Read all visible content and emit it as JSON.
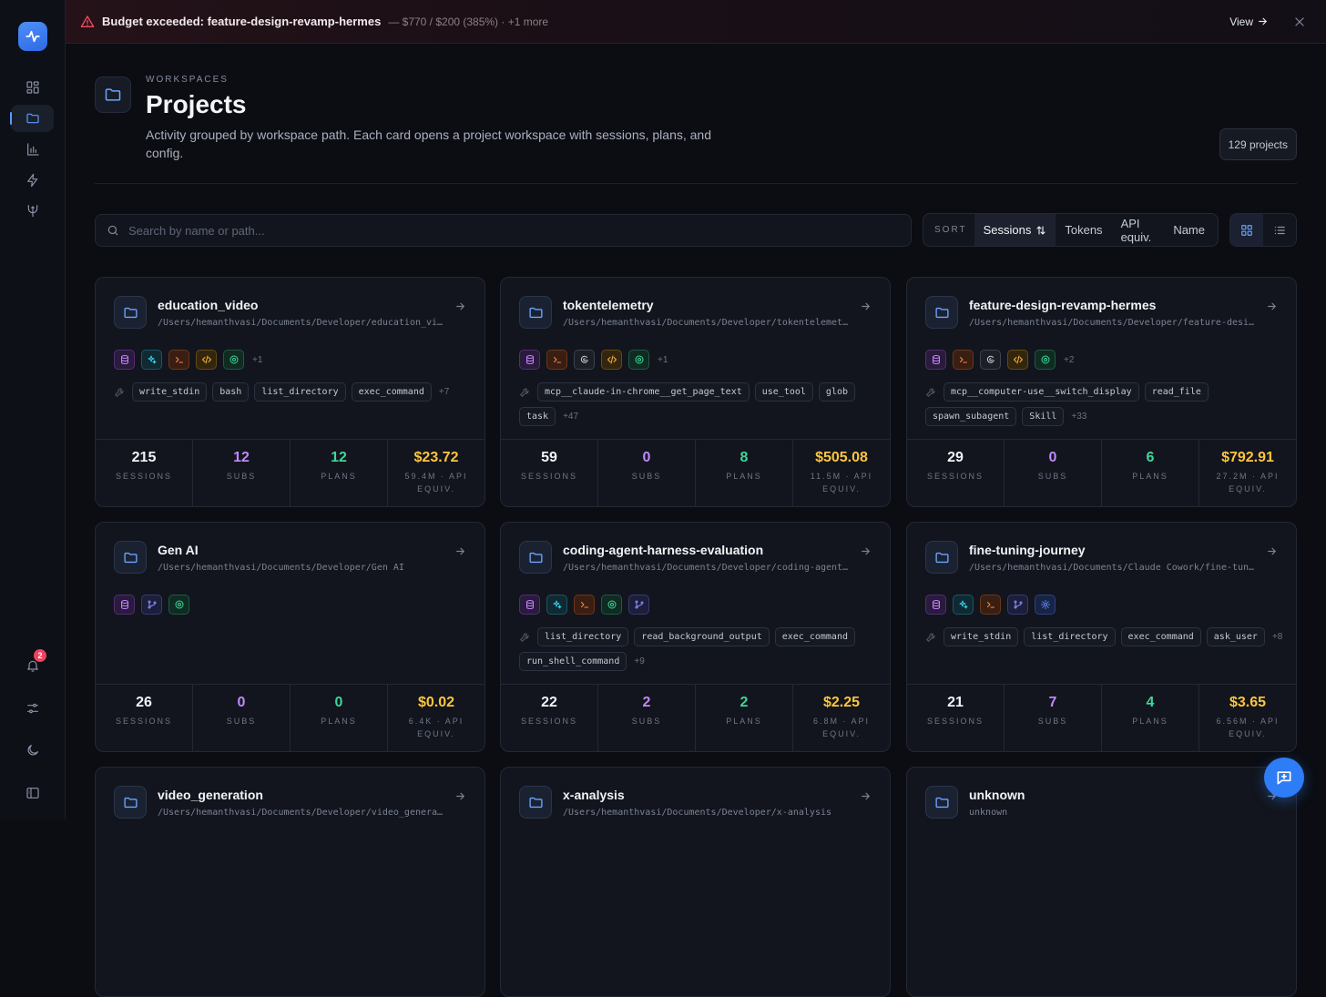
{
  "banner": {
    "title": "Budget exceeded: feature-design-revamp-hermes",
    "detail": "— $770 / $200 (385%) · +1 more",
    "view_label": "View"
  },
  "sidebar": {
    "notifications_count": "2"
  },
  "header": {
    "eyebrow": "WORKSPACES",
    "title": "Projects",
    "description": "Activity grouped by workspace path. Each card opens a project workspace with sessions, plans, and config.",
    "count": "129 projects"
  },
  "search": {
    "placeholder": "Search by name or path..."
  },
  "sort": {
    "label": "SORT",
    "options": [
      "Sessions",
      "Tokens",
      "API equiv.",
      "Name"
    ],
    "active": "Sessions"
  },
  "stat_labels": {
    "sessions": "SESSIONS",
    "subs": "SUBS",
    "plans": "PLANS"
  },
  "projects": [
    {
      "name": "education_video",
      "path": "/Users/hemanthvasi/Documents/Developer/education_video",
      "icons": [
        "db-icon",
        "ai-sparkle-icon",
        "terminal-icon",
        "code-icon",
        "gear-icon"
      ],
      "icons_more": "+1",
      "tags": [
        "write_stdin",
        "bash",
        "list_directory",
        "exec_command"
      ],
      "tags_more": "+7",
      "sessions": "215",
      "subs": "12",
      "plans": "12",
      "cost": "$23.72",
      "cost_label": "59.4M · API EQUIV."
    },
    {
      "name": "tokentelemetry",
      "path": "/Users/hemanthvasi/Documents/Developer/tokentelemetry",
      "icons": [
        "db-icon",
        "terminal-icon",
        "ring-icon",
        "code-icon",
        "gear-icon"
      ],
      "icons_more": "+1",
      "tags": [
        "mcp__claude-in-chrome__get_page_text",
        "use_tool",
        "glob",
        "task"
      ],
      "tags_more": "+47",
      "sessions": "59",
      "subs": "0",
      "plans": "8",
      "cost": "$505.08",
      "cost_label": "11.5M · API EQUIV."
    },
    {
      "name": "feature-design-revamp-hermes",
      "path": "/Users/hemanthvasi/Documents/Developer/feature-design-revamp-hermes",
      "icons": [
        "db-icon",
        "terminal-icon",
        "ring-icon",
        "code-icon",
        "gear-icon"
      ],
      "icons_more": "+2",
      "tags": [
        "mcp__computer-use__switch_display",
        "read_file",
        "spawn_subagent",
        "Skill"
      ],
      "tags_more": "+33",
      "sessions": "29",
      "subs": "0",
      "plans": "6",
      "cost": "$792.91",
      "cost_label": "27.2M · API EQUIV."
    },
    {
      "name": "Gen AI",
      "path": "/Users/hemanthvasi/Documents/Developer/Gen AI",
      "icons": [
        "db-icon",
        "git-icon",
        "gear-icon"
      ],
      "icons_more": "",
      "tags": [],
      "tags_more": "",
      "sessions": "26",
      "subs": "0",
      "plans": "0",
      "cost": "$0.02",
      "cost_label": "6.4K · API EQUIV."
    },
    {
      "name": "coding-agent-harness-evaluation",
      "path": "/Users/hemanthvasi/Documents/Developer/coding-agent-harness-evaluation",
      "icons": [
        "db-icon",
        "ai-sparkle-icon",
        "terminal-icon",
        "gear-icon",
        "git-icon"
      ],
      "icons_more": "",
      "tags": [
        "list_directory",
        "read_background_output",
        "exec_command",
        "run_shell_command"
      ],
      "tags_more": "+9",
      "sessions": "22",
      "subs": "2",
      "plans": "2",
      "cost": "$2.25",
      "cost_label": "6.8M · API EQUIV."
    },
    {
      "name": "fine-tuning-journey",
      "path": "/Users/hemanthvasi/Documents/Claude Cowork/fine-tuning-journey",
      "icons": [
        "db-icon",
        "ai-sparkle-icon",
        "terminal-icon",
        "git-icon",
        "cog-icon"
      ],
      "icons_more": "",
      "tags": [
        "write_stdin",
        "list_directory",
        "exec_command",
        "ask_user"
      ],
      "tags_more": "+8",
      "sessions": "21",
      "subs": "7",
      "plans": "4",
      "cost": "$3.65",
      "cost_label": "6.56M · API EQUIV."
    },
    {
      "name": "video_generation",
      "path": "/Users/hemanthvasi/Documents/Developer/video_generation",
      "icons": [],
      "icons_more": "",
      "tags": [],
      "tags_more": "",
      "sessions": "",
      "subs": "",
      "plans": "",
      "cost": "",
      "cost_label": ""
    },
    {
      "name": "x-analysis",
      "path": "/Users/hemanthvasi/Documents/Developer/x-analysis",
      "icons": [],
      "icons_more": "",
      "tags": [],
      "tags_more": "",
      "sessions": "",
      "subs": "",
      "plans": "",
      "cost": "",
      "cost_label": ""
    },
    {
      "name": "unknown",
      "path": "unknown",
      "icons": [],
      "icons_more": "",
      "tags": [],
      "tags_more": "",
      "sessions": "",
      "subs": "",
      "plans": "",
      "cost": "",
      "cost_label": ""
    }
  ],
  "colors": {
    "accent": "#2e7cf6",
    "danger": "#f04e62",
    "sessions": "#f1f3f7",
    "subs": "#c188ff",
    "plans": "#3fd69a",
    "cost": "#ffc53d"
  }
}
